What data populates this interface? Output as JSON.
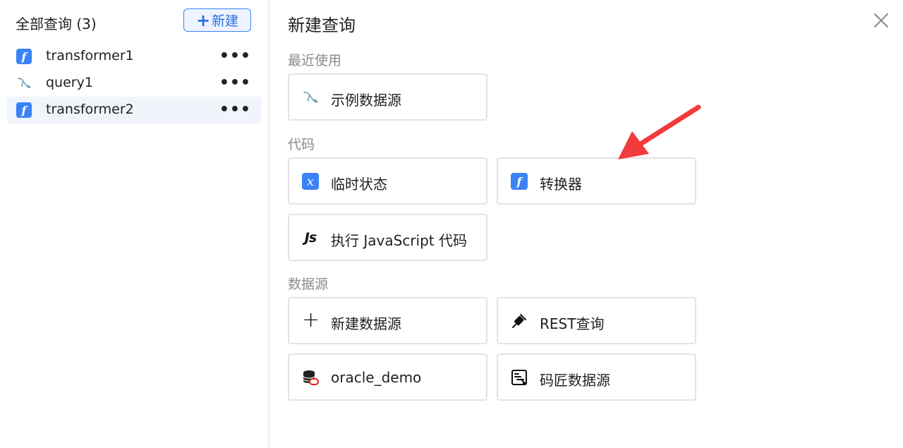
{
  "sidebar": {
    "title": "全部查询 (3)",
    "new_button_plus": "+",
    "new_button_label": "新建",
    "items": [
      {
        "name": "transformer1",
        "icon": "function-icon",
        "more": "•••"
      },
      {
        "name": "query1",
        "icon": "dolphin-icon",
        "more": "•••"
      },
      {
        "name": "transformer2",
        "icon": "function-icon",
        "more": "•••",
        "selected": true
      }
    ]
  },
  "main": {
    "title": "新建查询",
    "sections": {
      "recent": "最近使用",
      "code": "代码",
      "datasource": "数据源"
    },
    "cards": {
      "example_datasource": "示例数据源",
      "temp_state": "临时状态",
      "transformer": "转换器",
      "run_js": "执行 JavaScript 代码",
      "new_datasource": "新建数据源",
      "rest_query": "REST查询",
      "oracle_demo": "oracle_demo",
      "mj_datasource": "码匠数据源"
    },
    "icons": {
      "function": "f",
      "temp_state": "x",
      "js": "Js",
      "plus": "+"
    }
  },
  "colors": {
    "accent": "#3b82f6",
    "annotation_arrow": "#f23b3b",
    "border": "#e3e3e3",
    "section_label": "#8a8a8a"
  }
}
